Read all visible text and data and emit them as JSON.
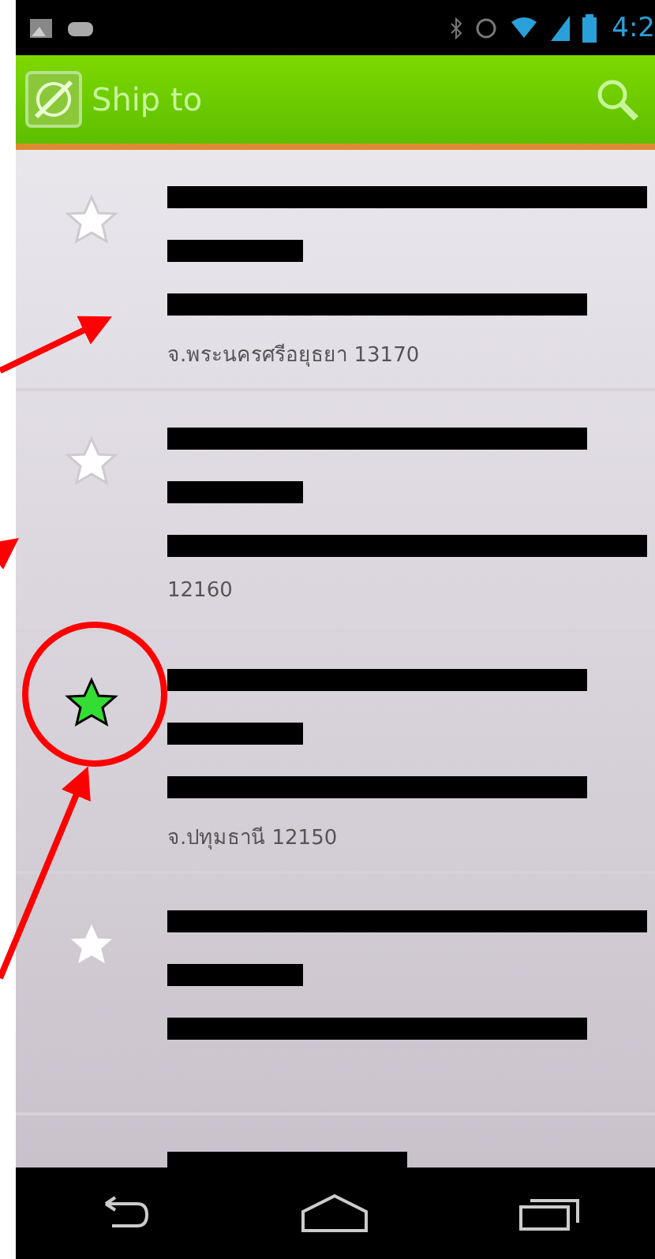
{
  "status_bar": {
    "time": "4:2"
  },
  "action_bar": {
    "title": "Ship to"
  },
  "addresses": [
    {
      "starred": false,
      "lines": [
        {
          "kind": "redacted"
        },
        {
          "kind": "redacted"
        },
        {
          "kind": "redacted"
        },
        {
          "kind": "text",
          "text": "จ.พระนครศรีอยุธยา 13170"
        }
      ]
    },
    {
      "starred": false,
      "lines": [
        {
          "kind": "redacted"
        },
        {
          "kind": "redacted"
        },
        {
          "kind": "redacted"
        },
        {
          "kind": "text",
          "text": "12160"
        }
      ]
    },
    {
      "starred": true,
      "lines": [
        {
          "kind": "redacted"
        },
        {
          "kind": "redacted"
        },
        {
          "kind": "redacted"
        },
        {
          "kind": "text",
          "text": "จ.ปทุมธานี 12150"
        }
      ]
    },
    {
      "starred": false,
      "lines": [
        {
          "kind": "redacted"
        },
        {
          "kind": "redacted"
        },
        {
          "kind": "redacted"
        }
      ]
    },
    {
      "lines": [
        {
          "kind": "redacted"
        }
      ]
    }
  ]
}
